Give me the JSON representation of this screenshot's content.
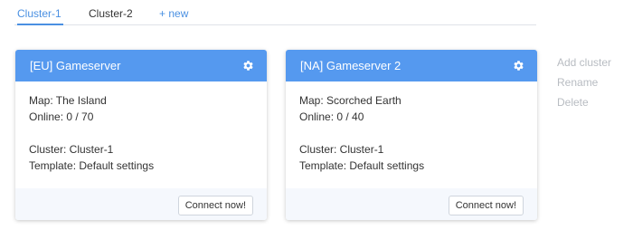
{
  "tabs": [
    {
      "label": "Cluster-1",
      "active": true
    },
    {
      "label": "Cluster-2",
      "active": false
    },
    {
      "label": "+ new",
      "active": false
    }
  ],
  "servers": [
    {
      "name": "[EU] Gameserver",
      "map": "Map: The Island",
      "online": "Online: 0 / 70",
      "cluster": "Cluster: Cluster-1",
      "template": "Template: Default settings",
      "connect_label": "Connect now!"
    },
    {
      "name": "[NA] Gameserver 2",
      "map": "Map: Scorched Earth",
      "online": "Online: 0 / 40",
      "cluster": "Cluster: Cluster-1",
      "template": "Template: Default settings",
      "connect_label": "Connect now!"
    }
  ],
  "side_actions": [
    "Add cluster",
    "Rename",
    "Delete"
  ],
  "icons": {
    "settings": "gear-icon"
  },
  "colors": {
    "accent": "#4a90e2",
    "card_header": "#5599ef",
    "footer_bg": "#f5f8fd",
    "side_action": "#b8bcc2"
  }
}
